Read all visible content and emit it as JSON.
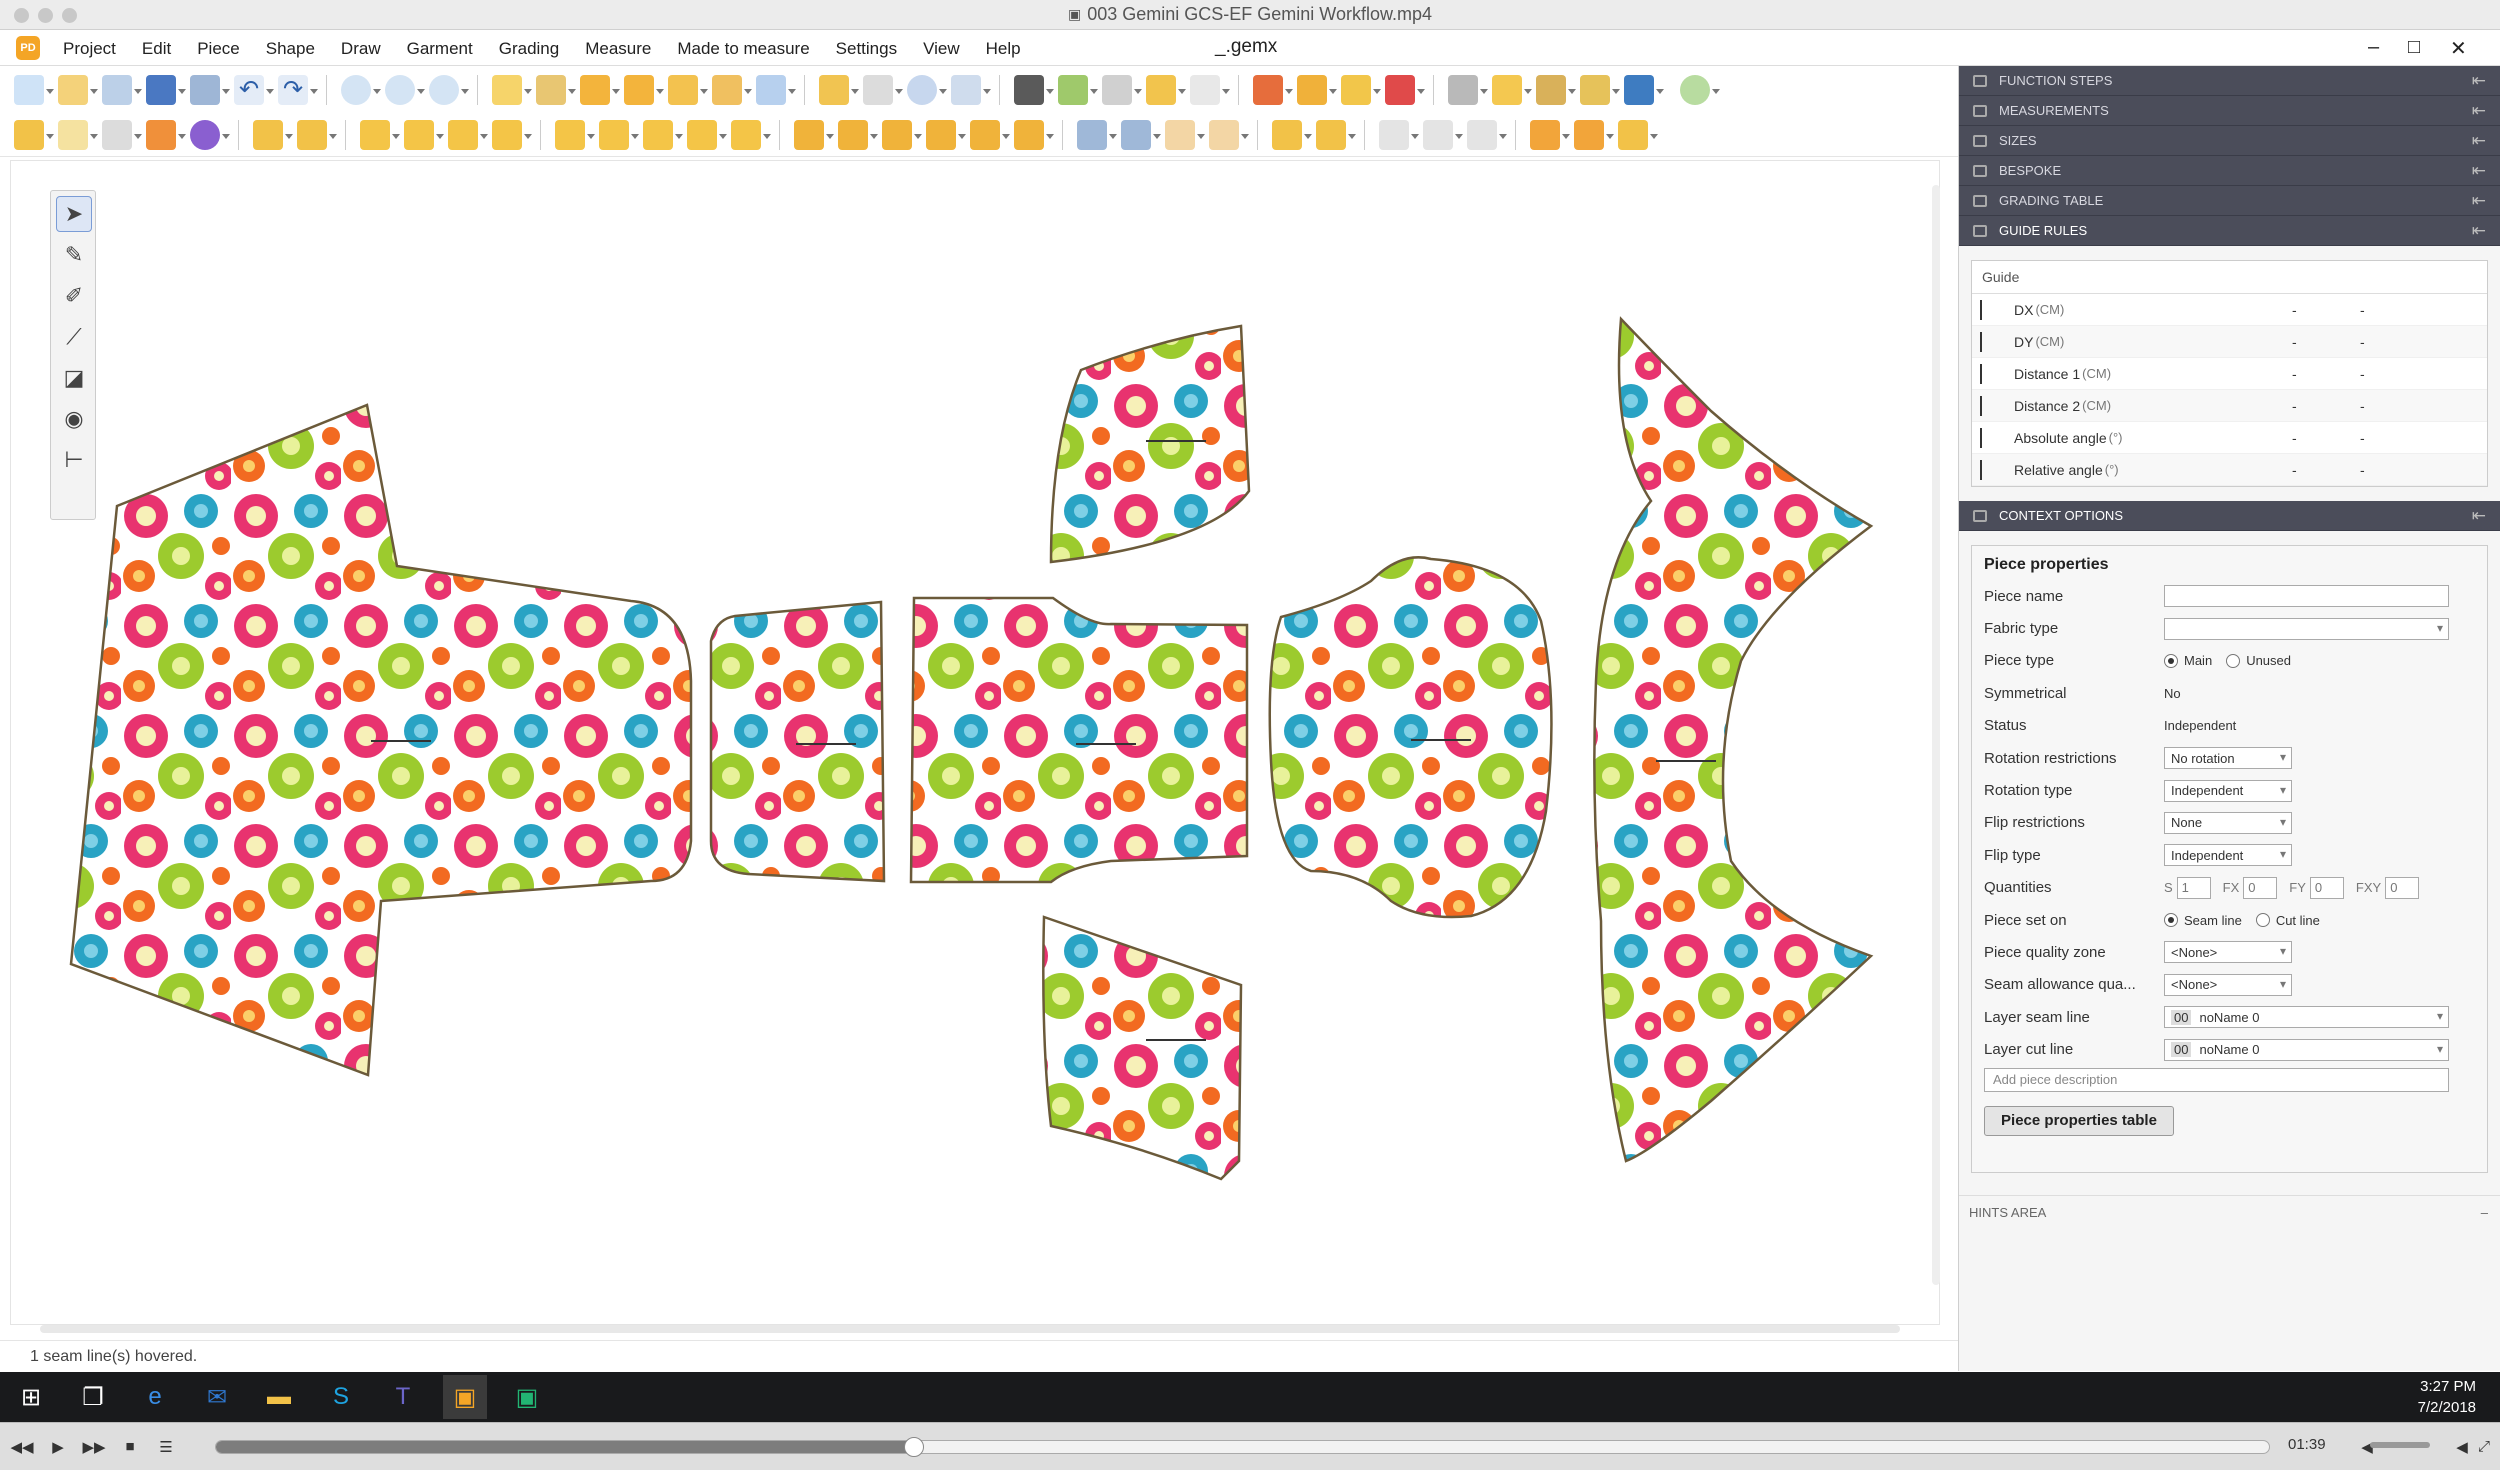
{
  "window": {
    "video_title": "003 Gemini GCS-EF Gemini Workflow.mp4",
    "doc_title": "_.gemx",
    "app_badge": "PD"
  },
  "menu": [
    "Project",
    "Edit",
    "Piece",
    "Shape",
    "Draw",
    "Garment",
    "Grading",
    "Measure",
    "Made to measure",
    "Settings",
    "View",
    "Help"
  ],
  "panels": {
    "function_steps": "FUNCTION STEPS",
    "measurements": "MEASUREMENTS",
    "sizes": "SIZES",
    "bespoke": "BESPOKE",
    "grading_table": "GRADING TABLE",
    "guide_rules": "GUIDE RULES",
    "context_options": "CONTEXT OPTIONS",
    "hints_area": "HINTS AREA"
  },
  "guide": {
    "title": "Guide",
    "rows": [
      {
        "label": "DX",
        "unit": "(CM)",
        "v1": "-",
        "v2": "-"
      },
      {
        "label": "DY",
        "unit": "(CM)",
        "v1": "-",
        "v2": "-"
      },
      {
        "label": "Distance 1",
        "unit": "(CM)",
        "v1": "-",
        "v2": "-"
      },
      {
        "label": "Distance 2",
        "unit": "(CM)",
        "v1": "-",
        "v2": "-"
      },
      {
        "label": "Absolute angle",
        "unit": "(°)",
        "v1": "-",
        "v2": "-"
      },
      {
        "label": "Relative angle",
        "unit": "(°)",
        "v1": "-",
        "v2": "-"
      }
    ]
  },
  "props": {
    "title": "Piece properties",
    "piece_name": "Piece name",
    "fabric_type": "Fabric type",
    "piece_type": "Piece type",
    "pt_main": "Main",
    "pt_unused": "Unused",
    "symmetrical": "Symmetrical",
    "symmetrical_val": "No",
    "status": "Status",
    "status_val": "Independent",
    "rot_restr": "Rotation restrictions",
    "rot_restr_val": "No rotation",
    "rot_type": "Rotation type",
    "rot_type_val": "Independent",
    "flip_restr": "Flip restrictions",
    "flip_restr_val": "None",
    "flip_type": "Flip type",
    "flip_type_val": "Independent",
    "quantities": "Quantities",
    "q_s": "S",
    "q_s_val": "1",
    "q_fx": "FX",
    "q_fx_val": "0",
    "q_fy": "FY",
    "q_fy_val": "0",
    "q_fxy": "FXY",
    "q_fxy_val": "0",
    "piece_set_on": "Piece set on",
    "pso_seam": "Seam line",
    "pso_cut": "Cut line",
    "quality_zone": "Piece quality zone",
    "quality_zone_val": "<None>",
    "sa_quality": "Seam allowance qua...",
    "sa_quality_val": "<None>",
    "layer_seam": "Layer seam line",
    "layer_seam_code": "00",
    "layer_seam_val": "noName 0",
    "layer_cut": "Layer cut line",
    "layer_cut_code": "00",
    "layer_cut_val": "noName 0",
    "desc_placeholder": "Add piece description",
    "table_btn": "Piece properties table"
  },
  "status_text": "1 seam line(s) hovered.",
  "clock": {
    "time": "3:27 PM",
    "date": "7/2/2018"
  },
  "player": {
    "time": "01:39",
    "progress": 0.34
  },
  "colors": {
    "panel_header": "#4b4d5a",
    "taskbar": "#191a1c",
    "flower_pink": "#e8336f",
    "flower_green": "#9ccb2e",
    "flower_teal": "#29a3c4",
    "flower_orange": "#f26a21"
  },
  "toolbox": [
    "select-arrow-icon",
    "draw-point-icon",
    "eraser-icon",
    "pipette-icon",
    "grading-icon",
    "tape-measure-icon",
    "guide-rule-icon"
  ]
}
